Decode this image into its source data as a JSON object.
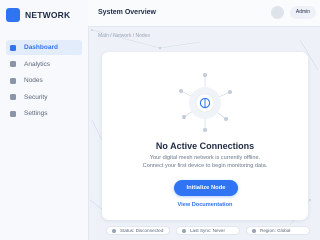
{
  "app": {
    "brand": "NETWORK"
  },
  "sidebar": {
    "items": [
      {
        "label": "Dashboard",
        "active": true
      },
      {
        "label": "Analytics",
        "active": false
      },
      {
        "label": "Nodes",
        "active": false
      },
      {
        "label": "Security",
        "active": false
      },
      {
        "label": "Settings",
        "active": false
      }
    ]
  },
  "header": {
    "title": "System Overview",
    "user_label": "Admin"
  },
  "breadcrumb": "Main / Network / Nodes",
  "empty_state": {
    "title": "No Active Connections",
    "description_line1": "Your digital mesh network is currently offline.",
    "description_line2": "Connect your first device to begin monitoring data.",
    "primary_action": "Initialize Node",
    "secondary_action": "View Documentation"
  },
  "status_bar": [
    {
      "text": "Status: Disconnected"
    },
    {
      "text": "Last Sync: Never"
    },
    {
      "text": "Region: Global"
    }
  ],
  "colors": {
    "accent": "#2f74f2",
    "background": "#eef2f8",
    "surface": "#ffffff",
    "text_primary": "#1f2a44",
    "text_muted": "#6b7789"
  },
  "icons": [
    "brand-logo-icon",
    "dashboard-icon",
    "analytics-icon",
    "nodes-icon",
    "security-icon",
    "settings-icon",
    "mesh-network-icon"
  ]
}
